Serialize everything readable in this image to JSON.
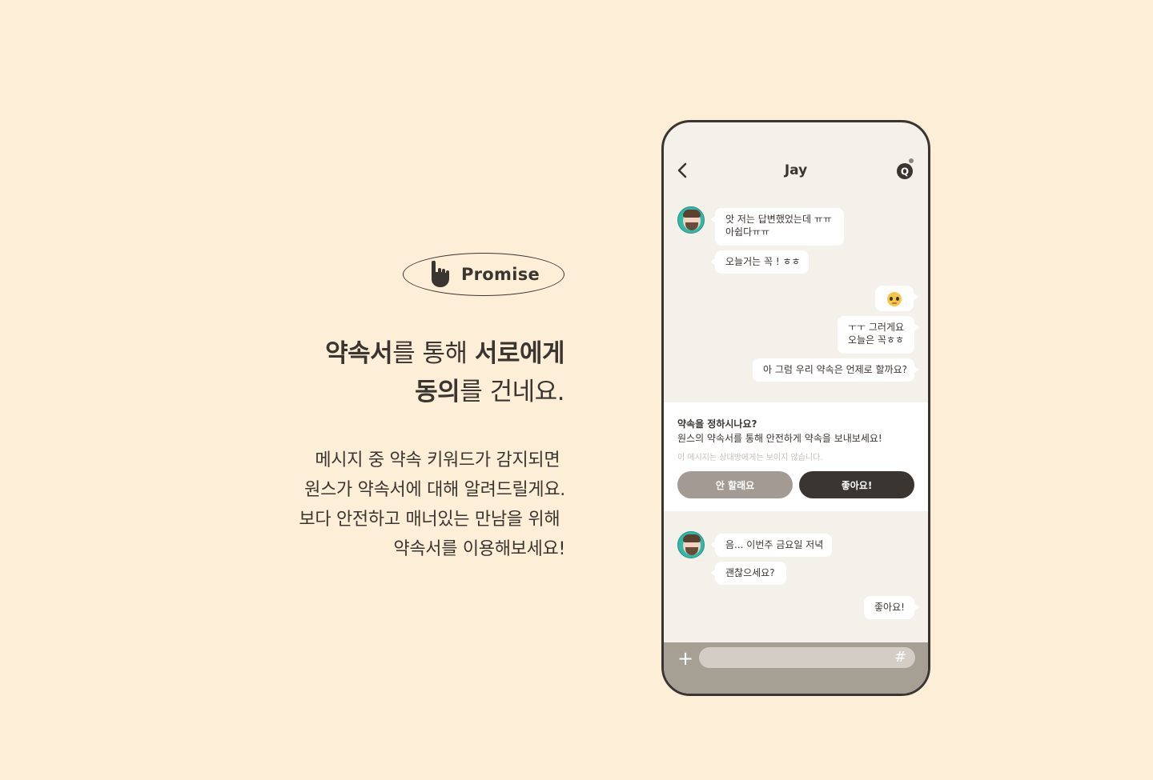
{
  "promo": {
    "badge_label": "Promise",
    "headline": [
      {
        "bold": "약속서",
        "regular": "를 통해 ",
        "bold2": "서로에게"
      },
      {
        "bold": "동의",
        "regular": "를 건네요.",
        "bold2": ""
      }
    ],
    "body": [
      "메시지 중 약속 키워드가 감지되면 ",
      "원스가 약속서에 대해 알려드릴게요.",
      "보다 안전하고 매너있는 만남을 위해 ",
      "약속서를 이용해보세요!"
    ]
  },
  "chat": {
    "title": "Jay",
    "search_icon_letter": "Q",
    "messages_top": [
      {
        "side": "in",
        "text": "앗 저는 답변했었는데 ㅠㅠ\n아쉽다ㅠㅠ"
      },
      {
        "side": "in",
        "text": "오늘거는 꼭 ! ㅎㅎ"
      },
      {
        "side": "out",
        "emoji": "pleading-face-emoji"
      },
      {
        "side": "out",
        "text": "ㅜㅜ 그러게요\n오늘은 꼭ㅎㅎ"
      },
      {
        "side": "out",
        "text": "아 그럼 우리 약속은 언제로 할까요?"
      }
    ],
    "prompt": {
      "title": "약속을 정하시나요?",
      "subtitle": "원스의 약속서를 통해 안전하게 약속을 보내보세요!",
      "note": "이 메시지는 상대방에게는 보이지 않습니다.",
      "decline_label": "안 할래요",
      "accept_label": "좋아요!"
    },
    "messages_bottom": [
      {
        "side": "in",
        "text": "음... 이번주 금요일 저녁"
      },
      {
        "side": "in",
        "text": "괜찮으세요?"
      },
      {
        "side": "out",
        "text": "좋아요!"
      }
    ],
    "composer": {
      "plus": "+",
      "hash": "#",
      "placeholder": ""
    }
  },
  "colors": {
    "background": "#fdefd7",
    "dark": "#3b3531",
    "muted_button": "#a39b93",
    "avatar_teal": "#2fb9a9",
    "chat_bg": "#f4f0ea",
    "composer_bg": "#a69f94"
  }
}
